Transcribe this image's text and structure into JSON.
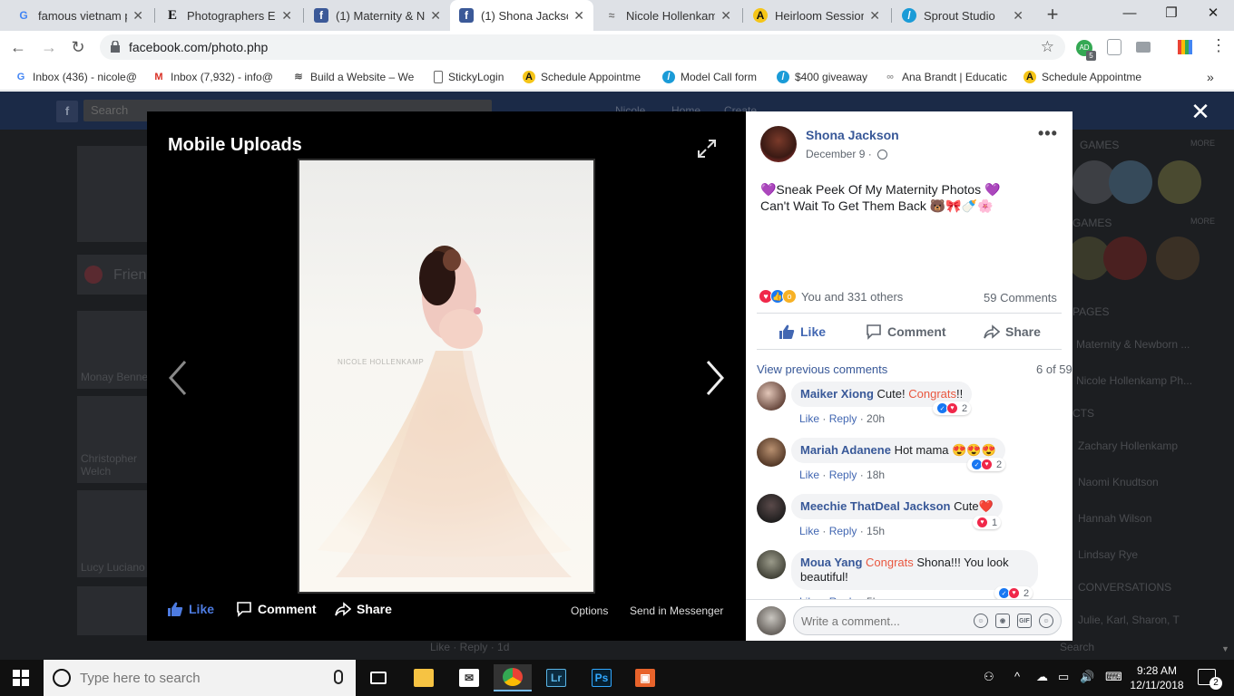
{
  "browser": {
    "tabs": [
      {
        "label": "famous vietnam pl",
        "icon": "google-icon"
      },
      {
        "label": "Photographers Ed",
        "icon": "e-icon"
      },
      {
        "label": "(1) Maternity & Ne",
        "icon": "facebook-icon"
      },
      {
        "label": "(1) Shona Jackson",
        "icon": "facebook-icon",
        "active": true
      },
      {
        "label": "Nicole Hollenkamp",
        "icon": "squarespace-icon"
      },
      {
        "label": "Heirloom Session",
        "icon": "acuity-icon"
      },
      {
        "label": "Sprout Studio",
        "icon": "sprout-icon"
      }
    ],
    "new_tab_label": "+",
    "url": "facebook.com/photo.php",
    "profile_badge": "5",
    "profile_initials": "AD",
    "bookmarks": [
      {
        "label": "Inbox (436) - nicole@",
        "icon": "google-icon"
      },
      {
        "label": "Inbox (7,932) - info@",
        "icon": "gmail-icon"
      },
      {
        "label": "Build a Website – We",
        "icon": "squarespace-icon"
      },
      {
        "label": "StickyLogin",
        "icon": "page-icon"
      },
      {
        "label": "Schedule Appointme",
        "icon": "acuity-icon"
      },
      {
        "label": "Model Call form",
        "icon": "sprout-icon"
      },
      {
        "label": "$400 giveaway",
        "icon": "sprout-icon"
      },
      {
        "label": "Ana Brandt | Educatic",
        "icon": "ana-icon"
      },
      {
        "label": "Schedule Appointme",
        "icon": "acuity-icon"
      }
    ],
    "bookmarks_overflow": "»"
  },
  "background": {
    "search_placeholder": "Search",
    "nav": [
      "Nicole",
      "Home",
      "Create"
    ],
    "friends_label": "Frien",
    "friends": [
      "Monay Benne",
      "Christopher Welch",
      "Lucy Luciano"
    ],
    "right_sections": [
      "GAMES",
      "GAMES",
      "PAGES",
      "CTS",
      "CONVERSATIONS"
    ],
    "more_label": "MORE",
    "right_items": [
      "Maternity & Newborn ...",
      "Nicole Hollenkamp Ph...",
      "Zachary Hollenkamp",
      "Naomi Knudtson",
      "Hannah Wilson",
      "Lindsay Rye",
      "Julie, Karl, Sharon, T"
    ],
    "search_bottom": "Search",
    "below_viewer": "Like · Reply · 1d"
  },
  "viewer": {
    "album_title": "Mobile Uploads",
    "watermark": "NICOLE HOLLENKAMP",
    "like_label": "Like",
    "comment_label": "Comment",
    "share_label": "Share",
    "options_label": "Options",
    "messenger_label": "Send in Messenger"
  },
  "post": {
    "author": "Shona Jackson",
    "date": "December 9 ·",
    "text_line1": "💜Sneak Peek Of My Maternity Photos 💜",
    "text_line2": "Can't Wait To Get Them Back 🐻🎀🍼🌸",
    "reactions_text": "You and 331 others",
    "comments_count": "59 Comments",
    "like_label": "Like",
    "comment_label": "Comment",
    "share_label": "Share",
    "view_previous": "View previous comments",
    "pagination": "6 of 59",
    "write_placeholder": "Write a comment..."
  },
  "comments": [
    {
      "name": "Maiker Xiong",
      "before": "Cute! ",
      "highlight": "Congrats",
      "after": "!!",
      "like": "Like",
      "reply": "Reply",
      "time": "20h",
      "reaction_count": "2"
    },
    {
      "name": "Mariah Adanene",
      "before": "Hot mama 😍😍😍",
      "highlight": "",
      "after": "",
      "like": "Like",
      "reply": "Reply",
      "time": "18h",
      "reaction_count": "2"
    },
    {
      "name": "Meechie ThatDeal Jackson",
      "before": "Cute❤️",
      "highlight": "",
      "after": "",
      "like": "Like",
      "reply": "Reply",
      "time": "15h",
      "reaction_count": "1"
    },
    {
      "name": "Moua Yang",
      "before": "",
      "highlight": "Congrats",
      "after": " Shona!!! You look beautiful!",
      "like": "Like",
      "reply": "Reply",
      "time": "5h",
      "reaction_count": "2"
    }
  ],
  "taskbar": {
    "search_placeholder": "Type here to search",
    "time": "9:28 AM",
    "date": "12/11/2018",
    "notifications": "2"
  },
  "colors": {
    "facebook_blue": "#4267b2",
    "link_blue": "#385898",
    "highlight_orange": "#e9573f"
  }
}
